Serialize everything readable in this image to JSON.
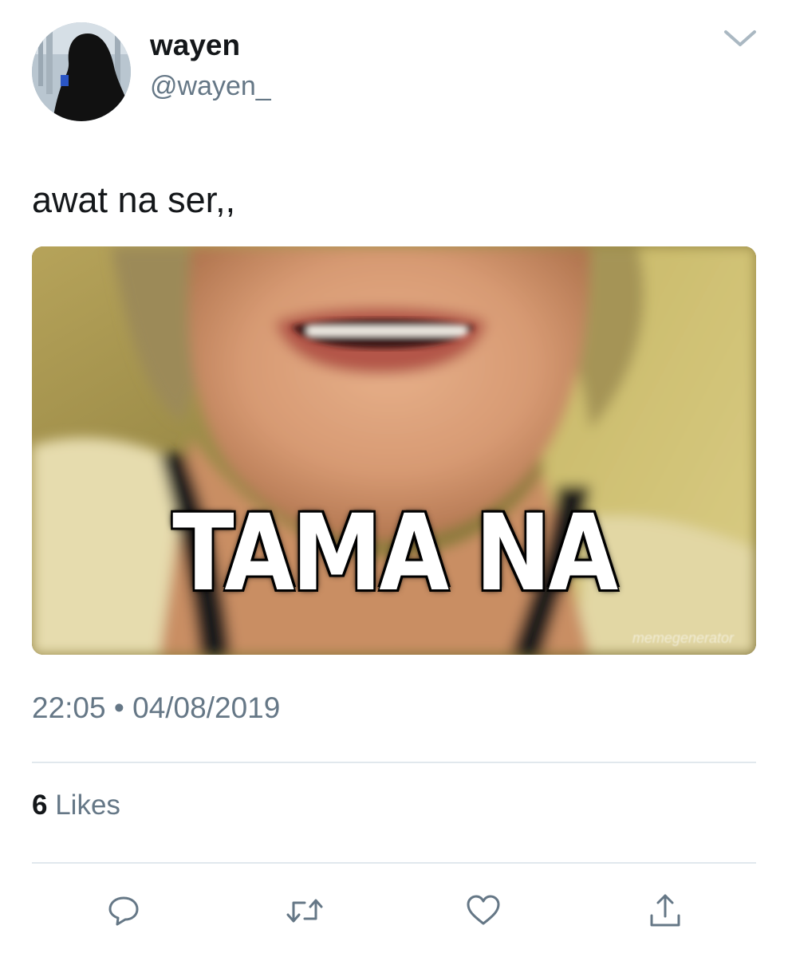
{
  "author": {
    "display_name": "wayen",
    "handle": "@wayen_",
    "avatar_icon": "avatar-silhouette-icon"
  },
  "tweet": {
    "text": "awat na ser,,",
    "media": {
      "caption": "TAMA NA",
      "watermark": "memegenerator"
    },
    "time": "22:05",
    "separator": "•",
    "date": "04/08/2019"
  },
  "stats": {
    "likes_count": "6",
    "likes_label": "Likes"
  },
  "actions": [
    {
      "name": "reply",
      "icon": "reply-bubble-icon"
    },
    {
      "name": "retweet",
      "icon": "retweet-icon"
    },
    {
      "name": "like",
      "icon": "heart-icon"
    },
    {
      "name": "share",
      "icon": "share-icon"
    }
  ],
  "colors": {
    "text_primary": "#14171a",
    "text_secondary": "#657786",
    "divider": "#e1e8ed",
    "icon": "#657786"
  }
}
